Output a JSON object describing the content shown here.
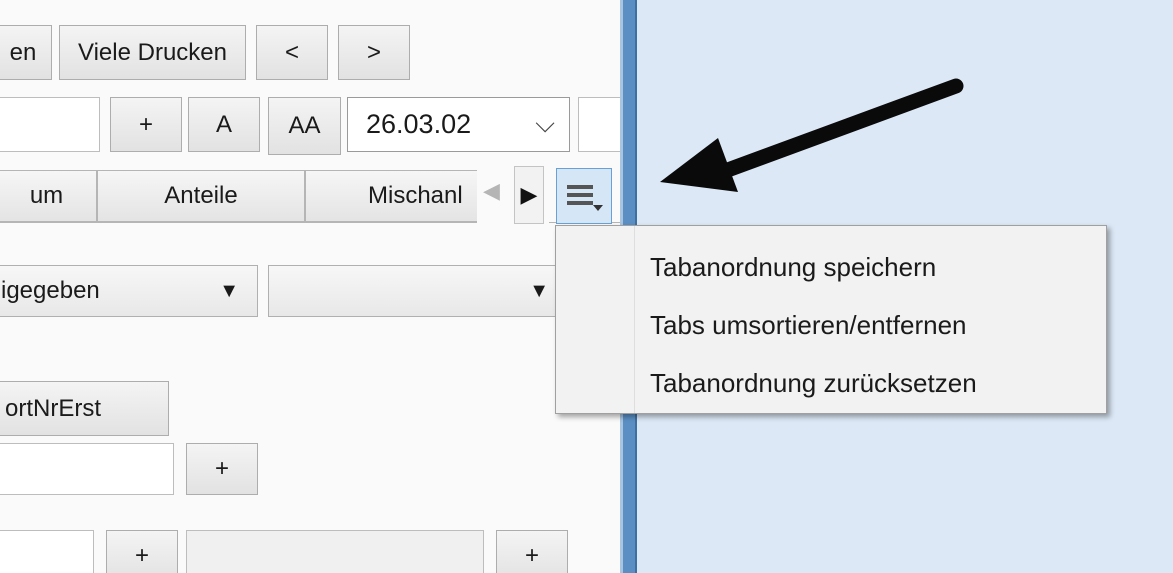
{
  "toolbar_top": {
    "partial_button": "en",
    "print_many_button": "Viele Drucken",
    "prev_button": "<",
    "next_button": ">"
  },
  "toolbar_second": {
    "plus_button": "+",
    "font_small_button": "A",
    "font_large_button": "AA",
    "date_value": "26.03.02",
    "date_dropdown_icon": "chevron-down"
  },
  "tabs": [
    {
      "label": "um"
    },
    {
      "label": "Anteile"
    },
    {
      "label": "Mischanl"
    }
  ],
  "tab_scroll": {
    "left_icon": "◀",
    "right_icon": "▶",
    "menu_icon": "hamburger-menu-with-dropdown"
  },
  "filters": {
    "combo1_value": "igegeben",
    "combo_arrow": "▼"
  },
  "form": {
    "sort_button": "ortNrErst",
    "plus_label": "+"
  },
  "tab_menu": {
    "items": [
      {
        "label": "Tabanordnung speichern"
      },
      {
        "label": "Tabs umsortieren/entfernen"
      },
      {
        "label": "Tabanordnung zurücksetzen"
      }
    ]
  },
  "colors": {
    "right_panel_bg": "#dce8f6",
    "divider": "#5b8fc4",
    "menu_button_highlight": "#d5e6f7"
  }
}
